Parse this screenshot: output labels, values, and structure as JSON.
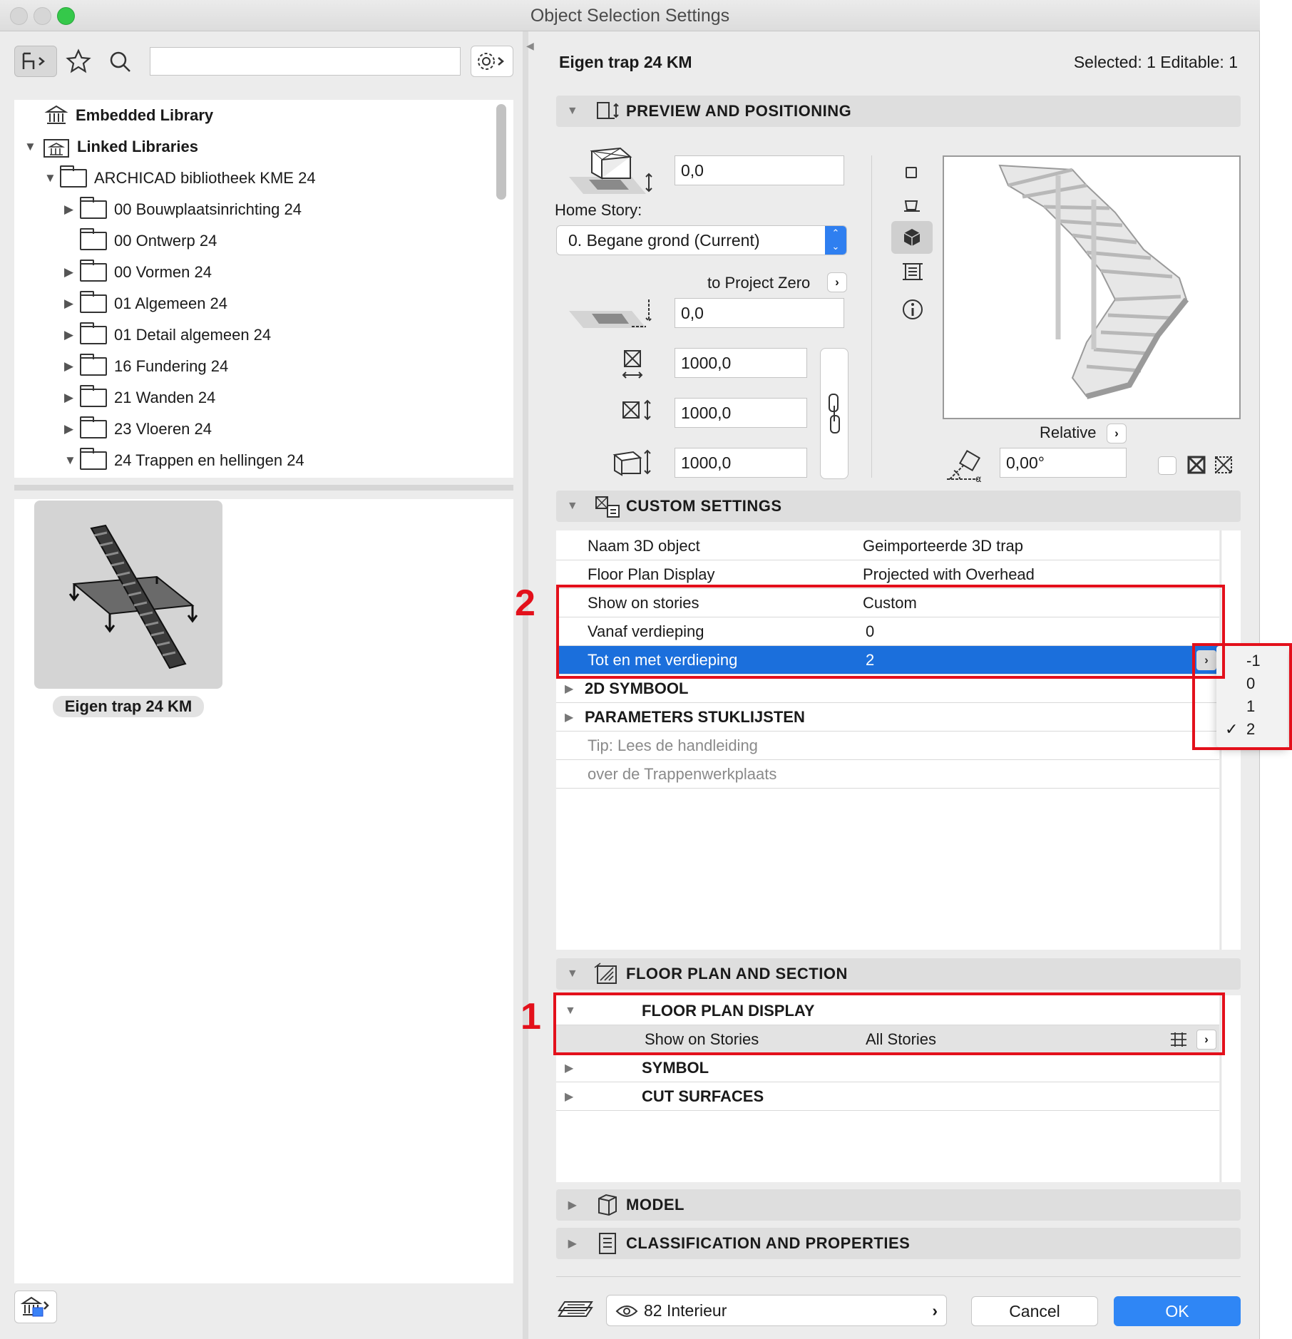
{
  "window": {
    "title": "Object Selection Settings"
  },
  "library": {
    "search_placeholder": "",
    "items": [
      {
        "label": "Embedded Library"
      },
      {
        "label": "Linked Libraries"
      },
      {
        "label": "ARCHICAD bibliotheek KME 24"
      },
      {
        "label": "00 Bouwplaatsinrichting 24"
      },
      {
        "label": "00 Ontwerp 24"
      },
      {
        "label": "00 Vormen 24"
      },
      {
        "label": "01 Algemeen 24"
      },
      {
        "label": "01 Detail algemeen 24"
      },
      {
        "label": "16 Fundering 24"
      },
      {
        "label": "21 Wanden 24"
      },
      {
        "label": "23 Vloeren 24"
      },
      {
        "label": "24 Trappen en hellingen 24"
      }
    ],
    "selected_object": "Eigen trap 24 KM"
  },
  "header": {
    "object_name": "Eigen trap 24 KM",
    "selected_info": "Selected: 1 Editable: 1"
  },
  "preview": {
    "section_title": "PREVIEW AND POSITIONING",
    "offset_value": "0,0",
    "home_story_label": "Home Story:",
    "home_story_value": "0. Begane grond (Current)",
    "to_project_zero_label": "to Project Zero",
    "project_zero_value": "0,0",
    "width_value": "1000,0",
    "depth_value": "1000,0",
    "height_value": "1000,0",
    "relative_label": "Relative",
    "angle_value": "0,00°"
  },
  "custom": {
    "section_title": "CUSTOM SETTINGS",
    "rows": [
      {
        "key": "Naam 3D object",
        "value": "Geimporteerde 3D trap"
      },
      {
        "key": "Floor Plan Display",
        "value": "Projected with Overhead"
      },
      {
        "key": "Show on stories",
        "value": "Custom"
      },
      {
        "key": "Vanaf verdieping",
        "value": "0"
      },
      {
        "key": "Tot en met verdieping",
        "value": "2"
      }
    ],
    "groups": [
      "2D SYMBOOL",
      "PARAMETERS STUKLIJSTEN"
    ],
    "tips": [
      "Tip: Lees de handleiding",
      "over de Trappenwerkplaats"
    ],
    "dropdown_options": [
      "-1",
      "0",
      "1",
      "2"
    ],
    "dropdown_checked": "✓"
  },
  "floorplan": {
    "section_title": "FLOOR PLAN AND SECTION",
    "subsection": "FLOOR PLAN DISPLAY",
    "show_label": "Show on Stories",
    "show_value": "All Stories",
    "groups": [
      "SYMBOL",
      "CUT SURFACES"
    ]
  },
  "model": {
    "section_title": "MODEL"
  },
  "classification": {
    "section_title": "CLASSIFICATION AND PROPERTIES"
  },
  "footer": {
    "layer": "82 Interieur",
    "cancel": "Cancel",
    "ok": "OK"
  },
  "annotations": {
    "label1": "1",
    "label2": "2"
  },
  "colors": {
    "accent": "#1b6fdc",
    "highlight_red": "#e3101b",
    "ok_button": "#2f86f5"
  }
}
